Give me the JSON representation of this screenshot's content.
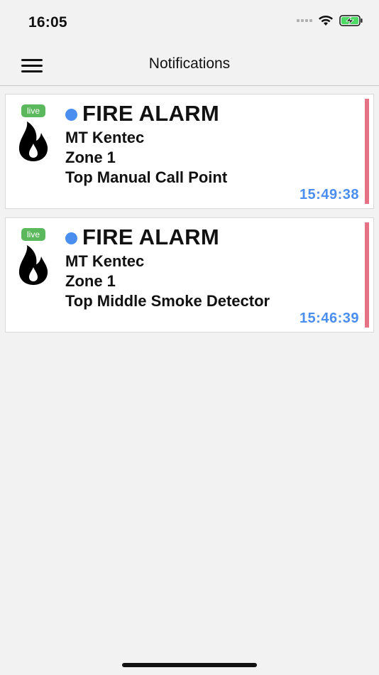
{
  "status_bar": {
    "time": "16:05"
  },
  "nav": {
    "title": "Notifications"
  },
  "notifications": [
    {
      "badge": "live",
      "title": "FIRE ALARM",
      "site": "MT Kentec",
      "zone": "Zone 1",
      "device": "Top Manual Call Point",
      "time": "15:49:38"
    },
    {
      "badge": "live",
      "title": "FIRE ALARM",
      "site": "MT Kentec",
      "zone": "Zone 1",
      "device": "Top Middle Smoke Detector",
      "time": "15:46:39"
    }
  ],
  "icons": {
    "menu": "hamburger-menu-icon",
    "alarm": "fire-icon",
    "wifi": "wifi-icon",
    "battery": "battery-charging-icon",
    "signal": "cellular-signal-icon"
  },
  "colors": {
    "background": "#f2f2f2",
    "live_badge": "#5cb85c",
    "status_dot": "#4a8ff0",
    "time_text": "#4a8ff0",
    "priority_bar": "#e57385",
    "battery_fill": "#4cd964"
  }
}
